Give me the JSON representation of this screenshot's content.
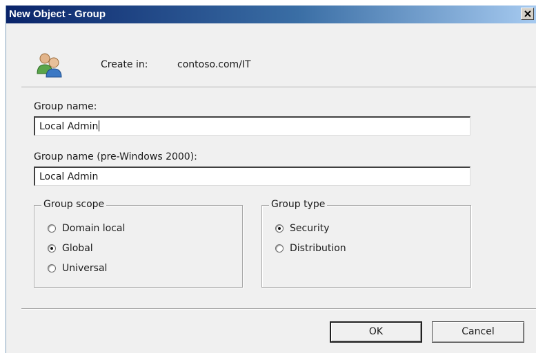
{
  "window": {
    "title": "New Object - Group",
    "close_glyph": "close-icon"
  },
  "header": {
    "icon": "group-users-icon",
    "create_in_label": "Create in:",
    "create_in_value": "contoso.com/IT"
  },
  "form": {
    "group_name_label": "Group name:",
    "group_name_value": "Local Admin",
    "pre2000_label": "Group name (pre-Windows 2000):",
    "pre2000_value": "Local Admin"
  },
  "group_scope": {
    "title": "Group scope",
    "options": [
      {
        "label": "Domain local",
        "checked": false
      },
      {
        "label": "Global",
        "checked": true
      },
      {
        "label": "Universal",
        "checked": false
      }
    ]
  },
  "group_type": {
    "title": "Group type",
    "options": [
      {
        "label": "Security",
        "checked": true
      },
      {
        "label": "Distribution",
        "checked": false
      }
    ]
  },
  "buttons": {
    "ok_label": "OK",
    "cancel_label": "Cancel"
  },
  "colors": {
    "titlebar_start": "#0a246a",
    "titlebar_end": "#a6caf0",
    "dialog_background": "#f0f0f0"
  }
}
